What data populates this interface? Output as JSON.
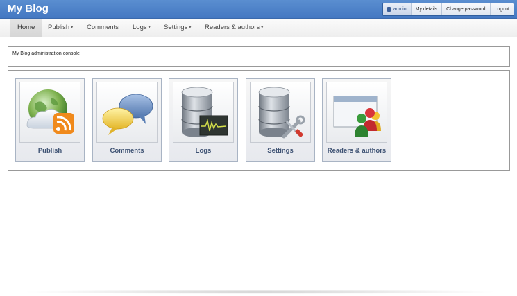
{
  "header": {
    "title": "My Blog",
    "user_menu": {
      "username": "admin",
      "my_details": "My details",
      "change_password": "Change password",
      "logout": "Logout"
    }
  },
  "nav": {
    "home": "Home",
    "publish": "Publish",
    "comments": "Comments",
    "logs": "Logs",
    "settings": "Settings",
    "readers_authors": "Readers & authors",
    "caret": "▾"
  },
  "console": {
    "text": "My Blog administration console"
  },
  "tiles": [
    {
      "label": "Publish",
      "icon": "globe-rss-icon"
    },
    {
      "label": "Comments",
      "icon": "speech-bubbles-icon"
    },
    {
      "label": "Logs",
      "icon": "database-log-icon"
    },
    {
      "label": "Settings",
      "icon": "database-tools-icon"
    },
    {
      "label": "Readers & authors",
      "icon": "users-window-icon"
    }
  ],
  "colors": {
    "header_blue": "#4a7fc6",
    "tile_label": "#3e5273"
  }
}
